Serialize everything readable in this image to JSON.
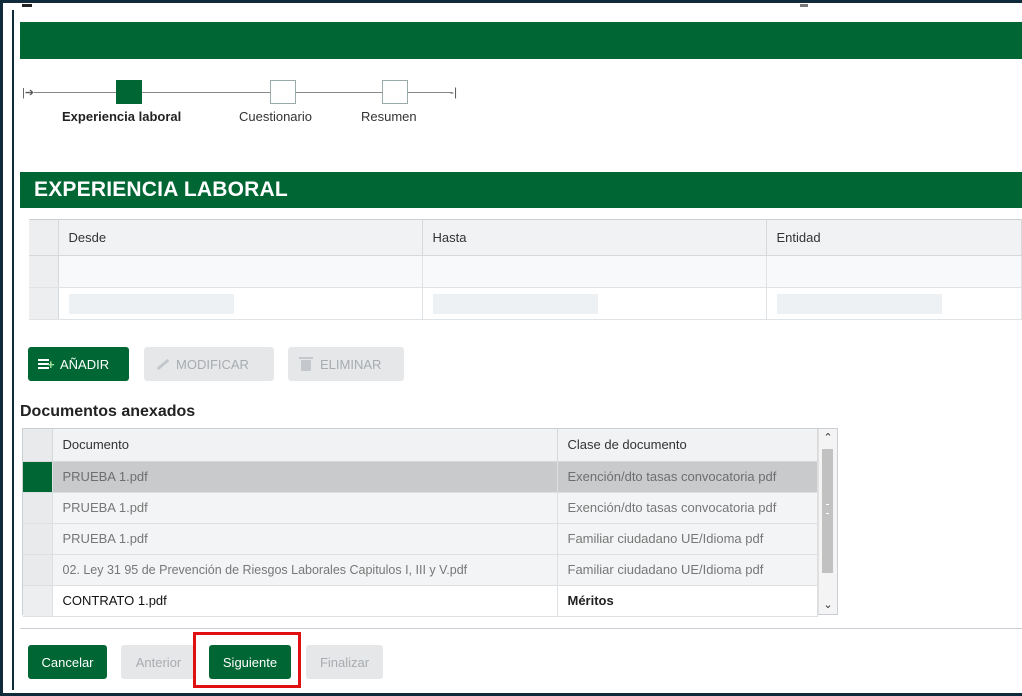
{
  "stepper": {
    "steps": [
      {
        "label": "Experiencia laboral",
        "active": true
      },
      {
        "label": "Cuestionario",
        "active": false
      },
      {
        "label": "Resumen",
        "active": false
      }
    ]
  },
  "section": {
    "title": "EXPERIENCIA LABORAL"
  },
  "experience_table": {
    "headers": [
      "Desde",
      "Hasta",
      "Entidad"
    ]
  },
  "actions": {
    "add_label": "AÑADIR",
    "edit_label": "MODIFICAR",
    "delete_label": "ELIMINAR"
  },
  "documents": {
    "title": "Documentos anexados",
    "headers": [
      "Documento",
      "Clase de documento"
    ],
    "rows": [
      {
        "documento": "PRUEBA 1.pdf",
        "clase": "Exención/dto tasas convocatoria pdf"
      },
      {
        "documento": "PRUEBA 1.pdf",
        "clase": "Exención/dto tasas convocatoria pdf"
      },
      {
        "documento": "PRUEBA 1.pdf",
        "clase": "Familiar ciudadano UE/Idioma pdf"
      },
      {
        "documento": "02. Ley 31 95 de Prevención de Riesgos Laborales Capitulos I, III y V.pdf",
        "clase": "Familiar ciudadano UE/Idioma pdf"
      },
      {
        "documento": "CONTRATO 1.pdf",
        "clase": "Méritos"
      }
    ]
  },
  "footer": {
    "cancel_label": "Cancelar",
    "prev_label": "Anterior",
    "next_label": "Siguiente",
    "finish_label": "Finalizar"
  },
  "colors": {
    "brand": "#006633",
    "highlight": "#e01010"
  }
}
